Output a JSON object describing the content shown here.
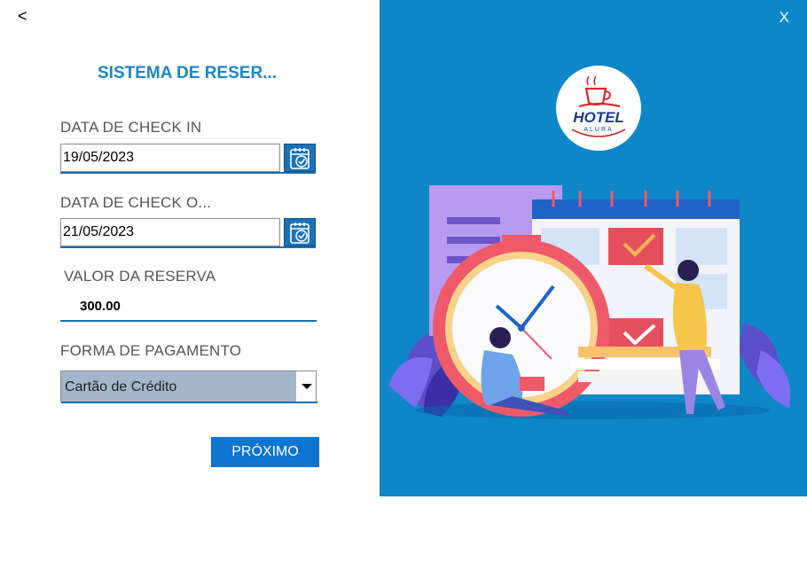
{
  "nav": {
    "back_label": "<",
    "close_label": "X"
  },
  "form": {
    "title": "SISTEMA DE RESER...",
    "checkin_label": "DATA DE CHECK IN",
    "checkin_value": "19/05/2023",
    "checkout_label": "DATA DE CHECK O...",
    "checkout_value": "21/05/2023",
    "valor_label": "VALOR DA RESERVA",
    "valor_value": "300.00",
    "pagamento_label": "FORMA DE PAGAMENTO",
    "pagamento_value": "Cartão de Crédito",
    "next_label": "PRÓXIMO"
  },
  "logo": {
    "line1": "HOTEL",
    "line2": "ALURA"
  },
  "icons": {
    "calendar": "calendar-check-icon",
    "dropdown": "chevron-down-icon",
    "logo_cup": "coffee-cup-icon"
  },
  "colors": {
    "panel": "#0f86c8",
    "accent": "#1a86c7",
    "button": "#0d74d0",
    "select_bg": "#a3b6cc",
    "logo_red": "#d52b2b"
  }
}
